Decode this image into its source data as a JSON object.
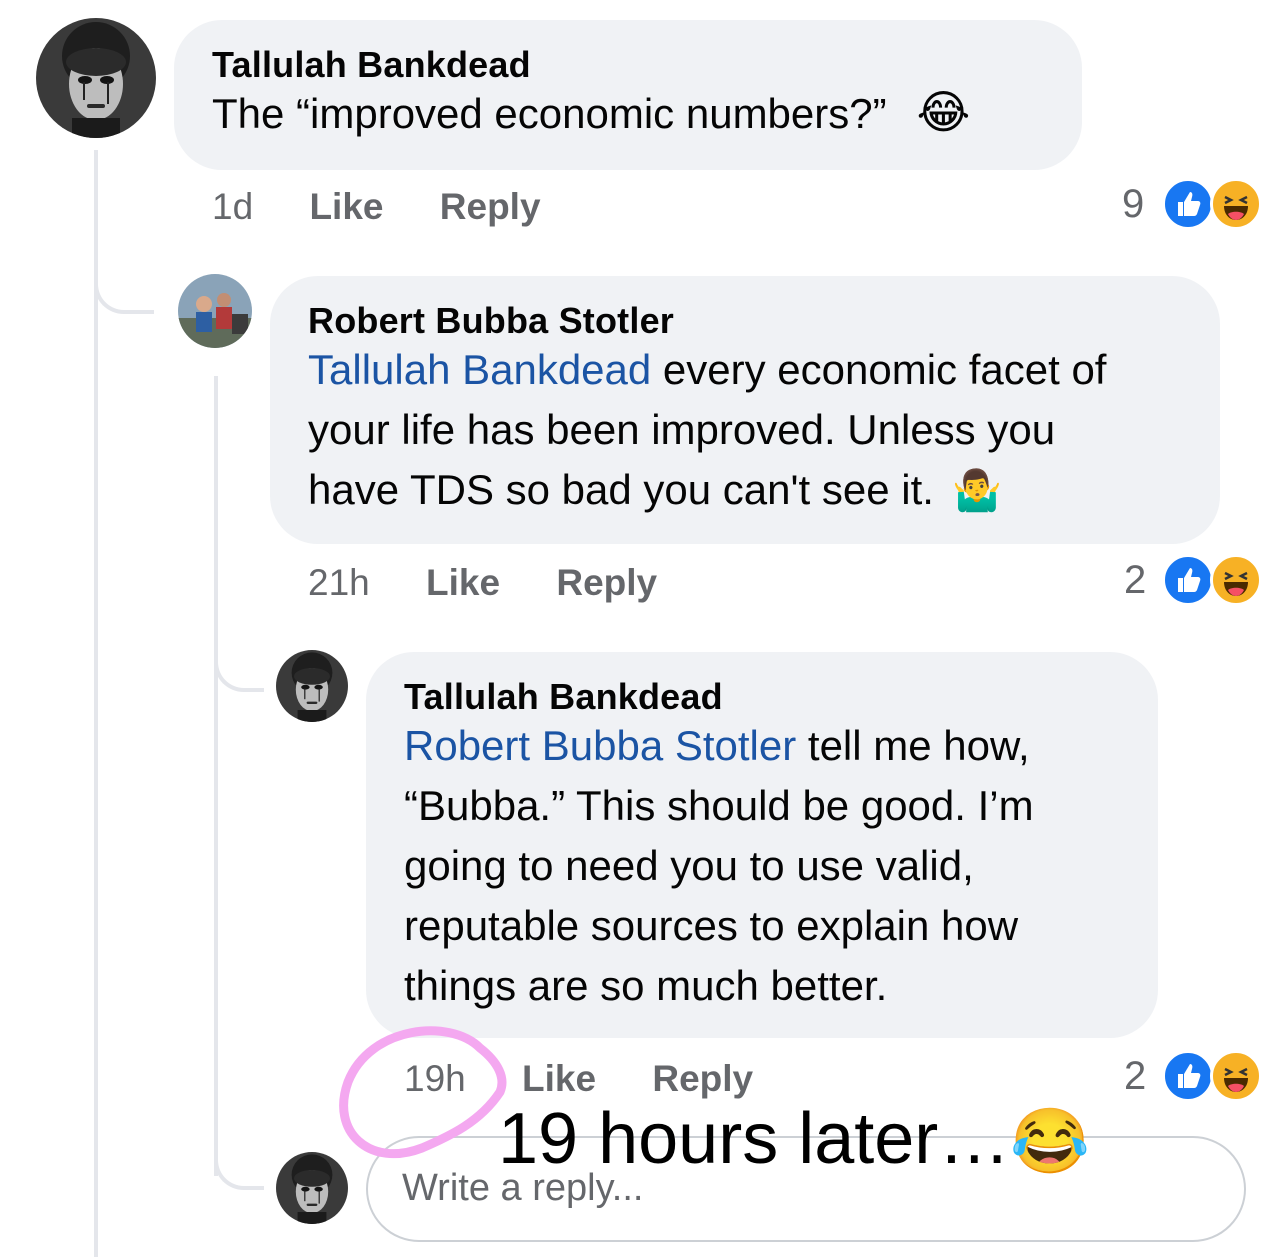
{
  "comments": [
    {
      "author": "Tallulah Bankdead",
      "text": "The “improved economic numbers?”",
      "emoji": "😂",
      "time": "1d",
      "like_label": "Like",
      "reply_label": "Reply",
      "reaction_count": "9"
    },
    {
      "author": "Robert Bubba Stotler",
      "mention": "Tallulah Bankdead",
      "text_l1": " every economic facet of",
      "text_l2": "your life has been improved. Unless you",
      "text_l3": "have TDS so bad you can't see it.",
      "emoji": "🤷‍♂️",
      "time": "21h",
      "like_label": "Like",
      "reply_label": "Reply",
      "reaction_count": "2"
    },
    {
      "author": "Tallulah Bankdead",
      "mention": "Robert Bubba Stotler",
      "text_l1": " tell me how,",
      "text_l2": "“Bubba.”  This should be good.  I’m",
      "text_l3": "going to need you to use valid,",
      "text_l4": "reputable sources to explain how",
      "text_l5": "things are so much better.",
      "time": "19h",
      "like_label": "Like",
      "reply_label": "Reply",
      "reaction_count": "2"
    }
  ],
  "reply_box": {
    "placeholder": "Write a reply..."
  },
  "overlay": {
    "text": "19 hours later…",
    "emoji": "😂",
    "circle_color": "#f4a8f0"
  },
  "colors": {
    "bubble": "#f0f2f5",
    "mention": "#1b54a4",
    "meta": "#65676b",
    "like": "#1877f2",
    "haha": "#f7b125"
  },
  "icons": [
    "like-reaction-icon",
    "haha-reaction-icon"
  ]
}
